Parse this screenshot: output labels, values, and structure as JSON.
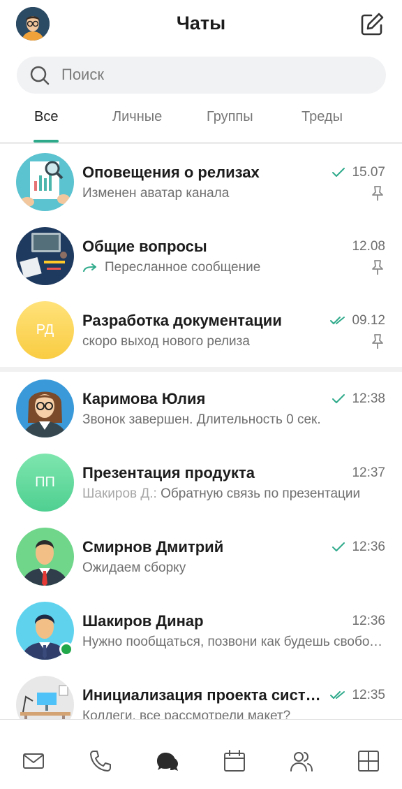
{
  "header": {
    "title": "Чаты"
  },
  "search": {
    "placeholder": "Поиск"
  },
  "tabs": [
    {
      "label": "Все",
      "active": true
    },
    {
      "label": "Личные",
      "active": false
    },
    {
      "label": "Группы",
      "active": false
    },
    {
      "label": "Треды",
      "active": false
    }
  ],
  "colors": {
    "accent": "#2eaa8a",
    "online": "#20a84a"
  },
  "chats": [
    {
      "name": "Оповещения о релизах",
      "message": "Изменен аватар канала",
      "time": "15.07",
      "status": "read-single",
      "pinned": true
    },
    {
      "name": "Общие вопросы",
      "message": "Пересланное сообщение",
      "time": "12.08",
      "status": "none",
      "pinned": true,
      "forwarded": true
    },
    {
      "name": "Разработка документации",
      "initials": "РД",
      "message": "скоро выход нового релиза",
      "time": "09.12",
      "status": "read-double",
      "pinned": true
    },
    {
      "name": "Каримова Юлия",
      "message": "Звонок завершен. Длительность 0 сек.",
      "time": "12:38",
      "status": "read-single"
    },
    {
      "name": "Презентация продукта",
      "initials": "ПП",
      "sender": "Шакиров Д.:",
      "message": "Обратную связь по презентации",
      "time": "12:37",
      "status": "none"
    },
    {
      "name": "Смирнов Дмитрий",
      "message": "Ожидаем сборку",
      "time": "12:36",
      "status": "read-single"
    },
    {
      "name": "Шакиров Динар",
      "message": "Нужно пообщаться, позвони как будешь свободен",
      "time": "12:36",
      "status": "none",
      "online": true
    },
    {
      "name": "Инициализация проекта системы",
      "message": "Коллеги, все рассмотрели макет?",
      "time": "12:35",
      "status": "read-double"
    }
  ],
  "bottom_nav": [
    {
      "icon": "mail-icon"
    },
    {
      "icon": "phone-icon"
    },
    {
      "icon": "chats-icon",
      "active": true
    },
    {
      "icon": "calendar-icon"
    },
    {
      "icon": "contacts-icon"
    },
    {
      "icon": "apps-icon"
    }
  ]
}
